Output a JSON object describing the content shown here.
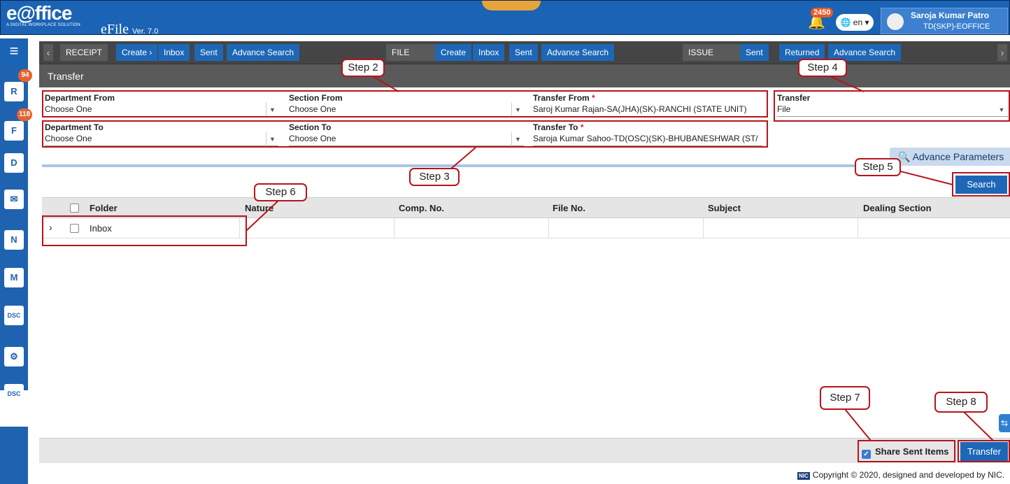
{
  "header": {
    "brand": "e@ffice",
    "tagline": "A DIGITAL WORKPLACE SOLUTION",
    "app_name": "eFile",
    "version": "Ver. 7.0",
    "notification_count": "2450",
    "language": "en",
    "user_name": "Saroja Kumar Patro",
    "user_role": "TD(SKP)-EOFFICE"
  },
  "menu": {
    "receipt": {
      "head": "RECEIPT",
      "create": "Create ›",
      "inbox": "Inbox",
      "sent": "Sent",
      "advance": "Advance Search"
    },
    "file": {
      "head": "FILE",
      "create": "Create",
      "inbox": "Inbox",
      "sent": "Sent",
      "advance": "Advance Search"
    },
    "issue": {
      "head": "ISSUE",
      "sent": "Sent",
      "returned": "Returned",
      "advance": "Advance Search"
    }
  },
  "sidebar": {
    "items": [
      {
        "icon": "receipt-icon",
        "glyph": "R",
        "badge": "94"
      },
      {
        "icon": "file-icon",
        "glyph": "F",
        "badge": "118"
      },
      {
        "icon": "dak-icon",
        "glyph": "D"
      },
      {
        "icon": "mail-icon",
        "glyph": "✉"
      },
      {
        "icon": "note-icon",
        "glyph": "N"
      },
      {
        "icon": "meeting-icon",
        "glyph": "M"
      },
      {
        "icon": "dsc-icon",
        "glyph": "DSC"
      },
      {
        "icon": "user-settings-icon",
        "glyph": "⚙"
      },
      {
        "icon": "dsc-icon",
        "glyph": "DSC"
      }
    ]
  },
  "page": {
    "title": "Transfer"
  },
  "form": {
    "dept_from": {
      "label": "Department From",
      "value": "Choose One"
    },
    "section_from": {
      "label": "Section From",
      "value": "Choose One"
    },
    "transfer_from": {
      "label": "Transfer From",
      "value": "Saroj Kumar Rajan-SA(JHA)(SK)-RANCHI (STATE UNIT)"
    },
    "transfer_type": {
      "label": "Transfer",
      "value": "File"
    },
    "dept_to": {
      "label": "Department To",
      "value": "Choose One"
    },
    "section_to": {
      "label": "Section To",
      "value": "Choose One"
    },
    "transfer_to": {
      "label": "Transfer To",
      "value": "Saroja Kumar Sahoo-TD(OSC)(SK)-BHUBANESHWAR (ST/"
    },
    "required_mark": "*"
  },
  "buttons": {
    "advance": "Advance Parameters",
    "search": "Search",
    "transfer": "Transfer",
    "share_sent": "Share Sent Items"
  },
  "table": {
    "columns": [
      "Folder",
      "Nature",
      "Comp. No.",
      "File No.",
      "Subject",
      "Dealing Section"
    ],
    "rows": [
      {
        "folder": "Inbox"
      }
    ]
  },
  "steps": {
    "s2": "Step 2",
    "s3": "Step 3",
    "s4": "Step 4",
    "s5": "Step 5",
    "s6": "Step 6",
    "s7": "Step 7",
    "s8": "Step 8"
  },
  "footer": {
    "copyright": "Copyright © 2020, designed and developed by NIC.",
    "nic": "NIC"
  }
}
